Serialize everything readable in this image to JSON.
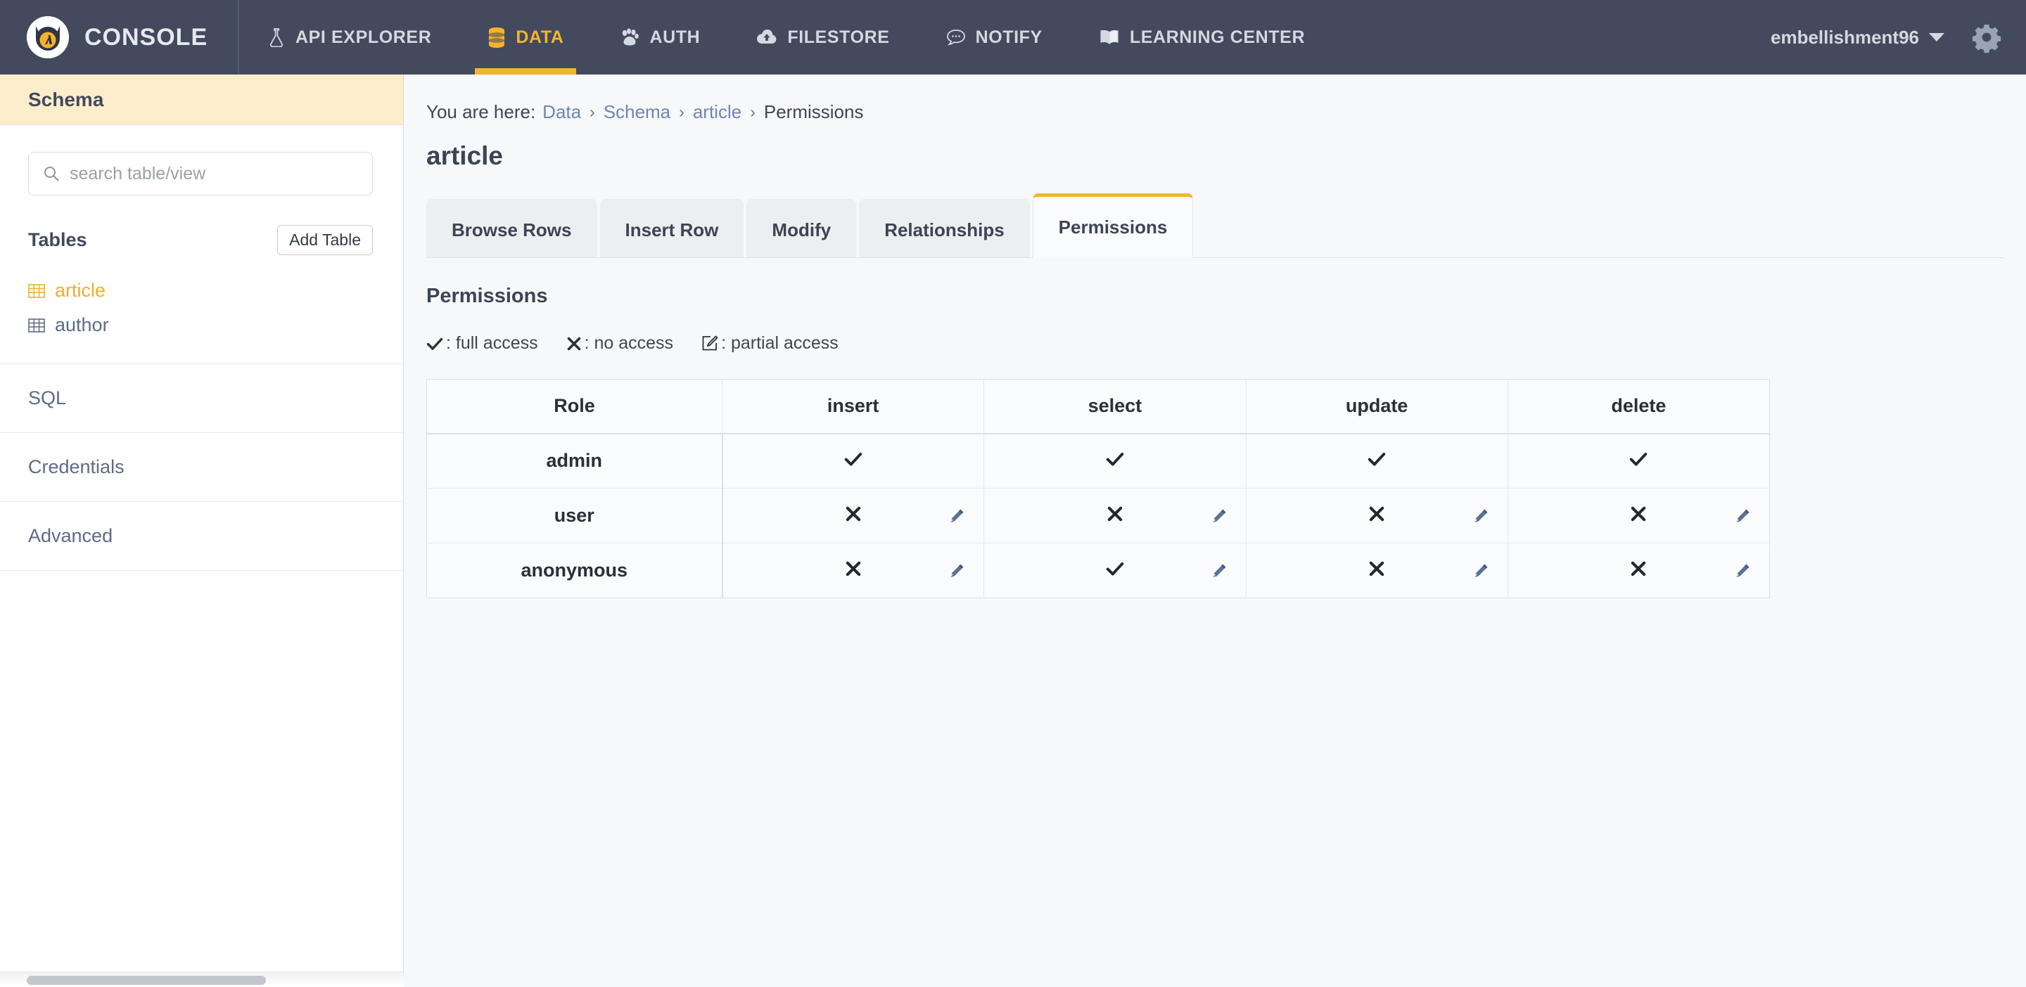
{
  "topnav": {
    "brand": "CONSOLE",
    "brand_logo_icon": "console-owl-logo",
    "items": [
      {
        "label": "API EXPLORER",
        "icon": "flask-icon",
        "active": false
      },
      {
        "label": "DATA",
        "icon": "database-stack-icon",
        "active": true
      },
      {
        "label": "AUTH",
        "icon": "paw-icon",
        "active": false
      },
      {
        "label": "FILESTORE",
        "icon": "cloud-upload-icon",
        "active": false
      },
      {
        "label": "NOTIFY",
        "icon": "speech-bubble-icon",
        "active": false
      },
      {
        "label": "LEARNING CENTER",
        "icon": "open-book-icon",
        "active": false
      }
    ],
    "username": "embellishment96",
    "caret_icon": "chevron-down-icon",
    "gear_icon": "gear-icon"
  },
  "sidebar": {
    "header": "Schema",
    "search": {
      "placeholder": "search table/view",
      "value": "",
      "icon": "search-icon"
    },
    "tables_label": "Tables",
    "add_table_label": "Add Table",
    "tables": [
      {
        "name": "article",
        "icon": "table-grid-icon",
        "active": true
      },
      {
        "name": "author",
        "icon": "table-grid-icon",
        "active": false
      }
    ],
    "links": [
      {
        "label": "SQL"
      },
      {
        "label": "Credentials"
      },
      {
        "label": "Advanced"
      }
    ]
  },
  "main": {
    "breadcrumb": {
      "prefix": "You are here:",
      "items": [
        {
          "label": "Data",
          "link": true
        },
        {
          "label": "Schema",
          "link": true
        },
        {
          "label": "article",
          "link": true
        },
        {
          "label": "Permissions",
          "link": false
        }
      ],
      "separator": "›"
    },
    "page_title": "article",
    "tabs": [
      {
        "label": "Browse Rows",
        "active": false
      },
      {
        "label": "Insert Row",
        "active": false
      },
      {
        "label": "Modify",
        "active": false
      },
      {
        "label": "Relationships",
        "active": false
      },
      {
        "label": "Permissions",
        "active": true
      }
    ],
    "section_title": "Permissions",
    "legend": [
      {
        "glyph": "✔",
        "icon": "check-icon",
        "text": ": full access"
      },
      {
        "glyph": "✖",
        "icon": "cross-icon",
        "text": ": no access"
      },
      {
        "glyph": "pencil-square",
        "icon": "edit-square-icon",
        "text": ": partial access"
      }
    ],
    "permissions_table": {
      "columns": [
        "Role",
        "insert",
        "select",
        "update",
        "delete"
      ],
      "rows": [
        {
          "role": "admin",
          "cells": [
            {
              "state": "full",
              "glyph": "✔",
              "editable": false
            },
            {
              "state": "full",
              "glyph": "✔",
              "editable": false
            },
            {
              "state": "full",
              "glyph": "✔",
              "editable": false
            },
            {
              "state": "full",
              "glyph": "✔",
              "editable": false
            }
          ]
        },
        {
          "role": "user",
          "cells": [
            {
              "state": "none",
              "glyph": "✖",
              "editable": true
            },
            {
              "state": "none",
              "glyph": "✖",
              "editable": true
            },
            {
              "state": "none",
              "glyph": "✖",
              "editable": true
            },
            {
              "state": "none",
              "glyph": "✖",
              "editable": true
            }
          ]
        },
        {
          "role": "anonymous",
          "cells": [
            {
              "state": "none",
              "glyph": "✖",
              "editable": true
            },
            {
              "state": "full",
              "glyph": "✔",
              "editable": true
            },
            {
              "state": "none",
              "glyph": "✖",
              "editable": true
            },
            {
              "state": "none",
              "glyph": "✖",
              "editable": true
            }
          ]
        }
      ]
    }
  },
  "colors": {
    "nav_bg": "#434a5e",
    "accent": "#f5b32c",
    "sidebar_header_bg": "#fdeecb",
    "link_blue": "#6f86b3",
    "edit_icon": "#5b7296",
    "text_dark": "#3d4454"
  }
}
